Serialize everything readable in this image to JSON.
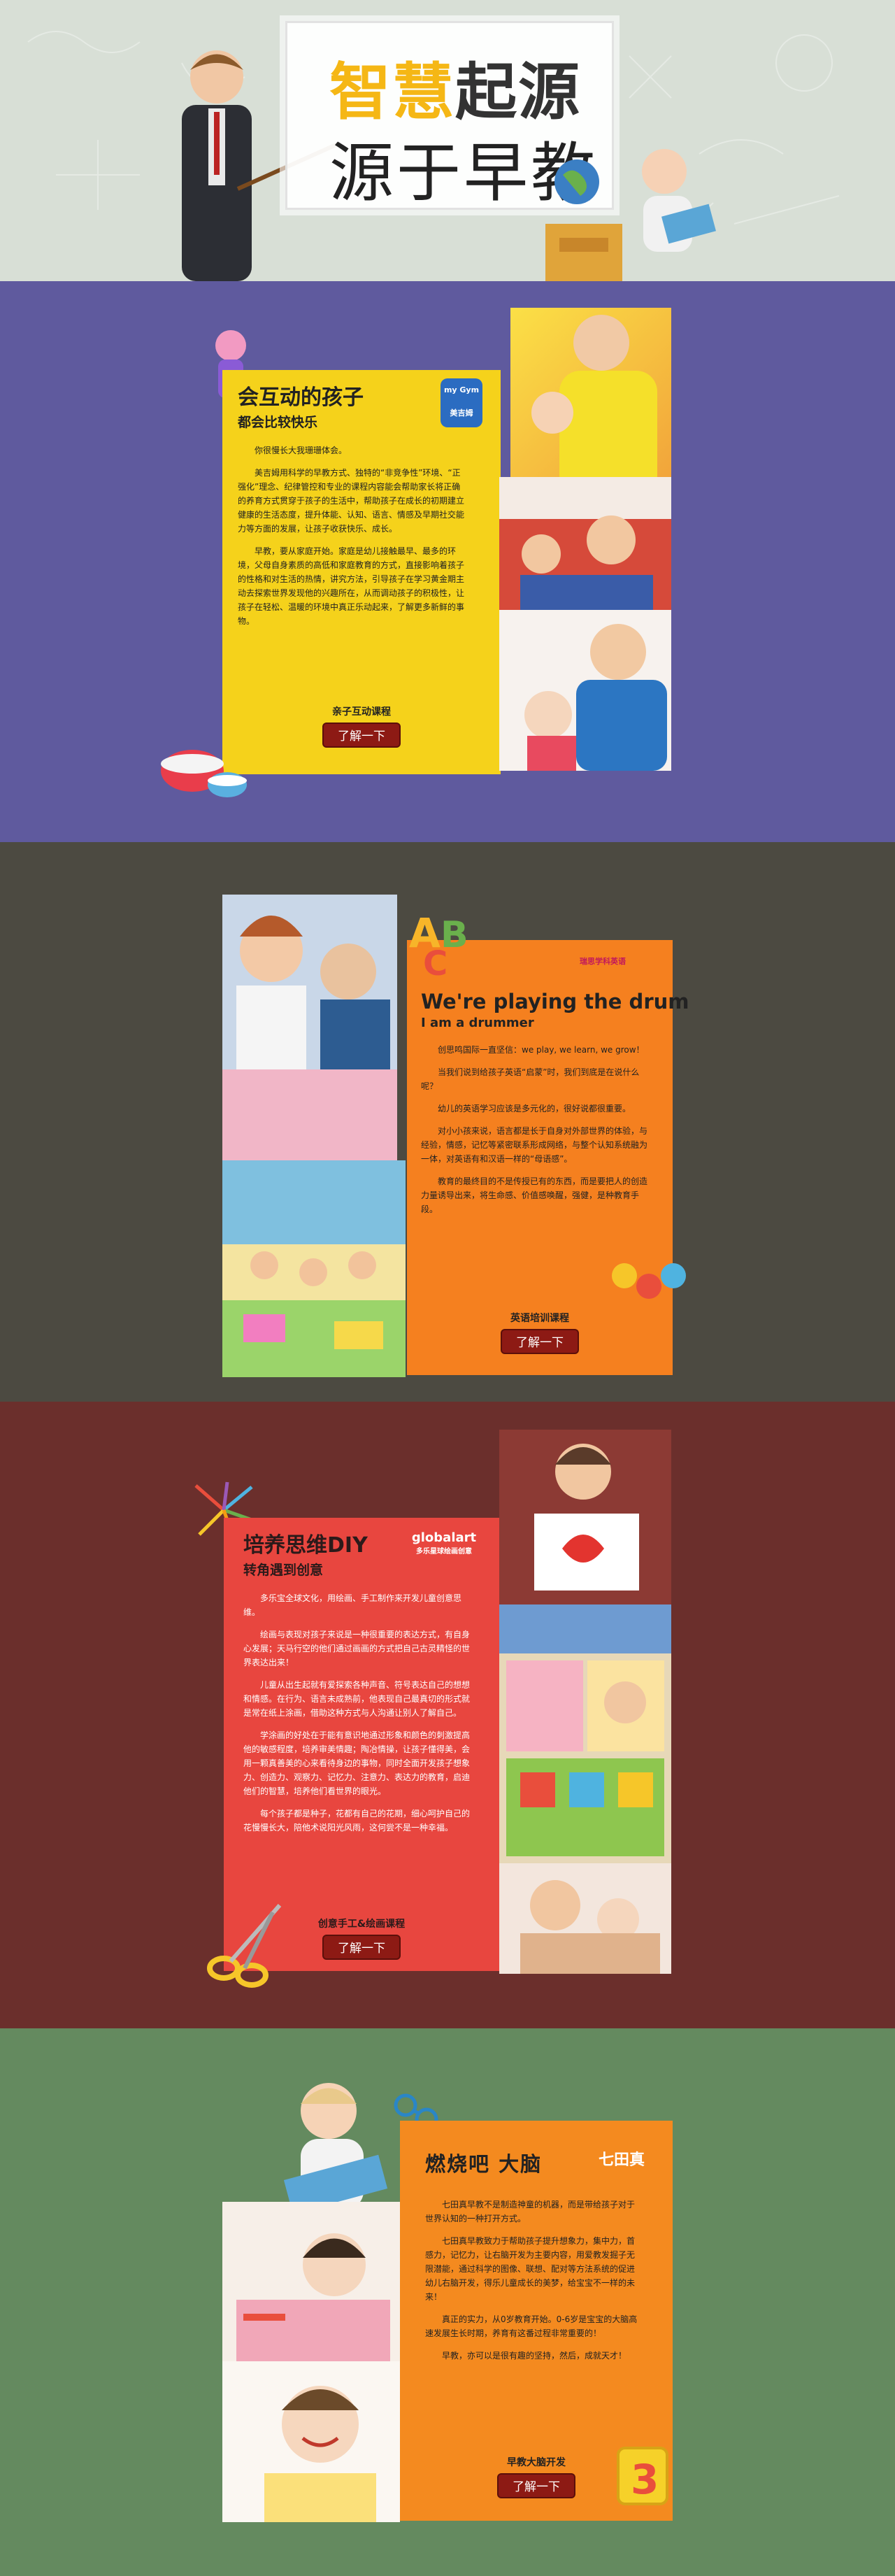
{
  "hero": {
    "line1_a": "智慧",
    "line1_b": "起源",
    "line2": "源于早教"
  },
  "section1": {
    "title": "会互动的孩子",
    "subtitle": "都会比较快乐",
    "logo_top": "my Gym",
    "logo_text": "美吉姆",
    "paragraphs": [
      "你很慢长大我珊珊体会。",
      "美吉姆用科学的早教方式、独特的“非竞争性”环境、“正强化”理念、纪律管控和专业的课程内容能会帮助家长将正确的养育方式贯穿于孩子的生活中，帮助孩子在成长的初期建立健康的生活态度，提升体能、认知、语言、情感及早期社交能力等方面的发展，让孩子收获快乐、成长。",
      "早教，要从家庭开始。家庭是幼儿接触最早、最多的环境，父母自身素质的高低和家庭教育的方式，直接影响着孩子的性格和对生活的热情，讲究方法，引导孩子在学习黄金期主动去探索世界发现他的兴趣所在，从而调动孩子的积极性，让孩子在轻松、温暖的环境中真正乐动起来，了解更多新鲜的事物。"
    ],
    "course": "亲子互动课程",
    "button": "了解一下"
  },
  "section2": {
    "title": "We're playing the drum",
    "subtitle": "I am a drummer",
    "logo_text": "瑞思学科英语",
    "paragraphs": [
      "创思鸣国际一直坚信：we play, we learn, we grow！",
      "当我们说到给孩子英语“启蒙”时，我们到底是在说什么呢？",
      "幼儿的英语学习应该是多元化的，很好说都很重要。",
      "对小小孩来说，语言都是长于自身对外部世界的体验，与经验，情感，记忆等紧密联系形成网络，与整个认知系统融为一体，对英语有和汉语一样的“母语感”。",
      "教育的最终目的不是传授已有的东西，而是要把人的创造力量诱导出来，将生命感、价值感唤醒，强健，是种教育手段。"
    ],
    "course": "英语培训课程",
    "button": "了解一下"
  },
  "section3": {
    "title": "培养思维DIY",
    "subtitle": "转角遇到创意",
    "logo_top": "globalart",
    "logo_text": "多乐星球绘画创意",
    "paragraphs": [
      "多乐宝全球文化，用绘画、手工制作来开发儿童创意思维。",
      "绘画与表现对孩子来说是一种很重要的表达方式，有自身心发展；天马行空的他们通过画画的方式把自己古灵精怪的世界表达出来！",
      "儿童从出生起就有爱探索各种声音、符号表达自己的想想和情感。在行为、语言未成熟前，他表现自己最真切的形式就是常在纸上涂画，借助这种方式与人沟通让别人了解自己。",
      "学涂画的好处在于能有意识地通过形象和颜色的刺激提高他的敏感程度，培养审美情趣；陶冶情操，让孩子懂得美，会用一颗真善美的心来看待身边的事物，同时全面开发孩子想象力、创造力、观察力、记忆力、注意力、表达力的教育，启迪他们的智慧，培养他们看世界的眼光。",
      "每个孩子都是种子，花都有自己的花期，细心呵护自己的花慢慢长大，陪他术说阳光风雨，这何尝不是一种幸福。"
    ],
    "course": "创意手工&绘画课程",
    "button": "了解一下"
  },
  "section4": {
    "title": "燃烧吧 大脑",
    "logo_text": "七田真",
    "paragraphs": [
      "七田真早教不是制造神童的机器，而是带给孩子对于世界认知的一种打开方式。",
      "七田真早教致力于帮助孩子提升想象力，集中力，首感力，记忆力，让右脑开发为主要内容，用爱教发掘子无限潜能，通过科学的图像、联想、配对等方法系统的促进幼儿右脑开发，得乐儿童成长的美梦，给宝宝不一样的未来！",
      "真正的实力，从0岁教育开始。0-6岁是宝宝的大脑高速发展生长时期，养育有这番过程非常重要的！",
      "早教，亦可以是很有趣的坚持，然后，成就天才！"
    ],
    "course": "早教大脑开发",
    "button": "了解一下"
  },
  "colors": {
    "yellow_panel": "#f5d21b",
    "orange_panel": "#f5801f",
    "red_panel": "#e8463f",
    "orange_panel_2": "#f48a1f",
    "button": "#8d1a14"
  }
}
